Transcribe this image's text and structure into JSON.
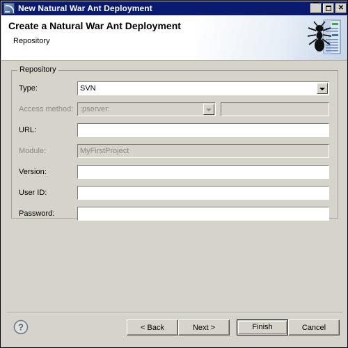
{
  "window": {
    "title": "New Natural War Ant Deployment",
    "icon": "wizard-window-icon",
    "controls": {
      "minimize": "minimize-button",
      "maximize": "maximize-button",
      "close": "close-button",
      "close_glyph": "✕"
    }
  },
  "header": {
    "title": "Create a Natural War Ant Deployment",
    "subtitle": "Repository",
    "icon": "ant-deployment-icon"
  },
  "repository_group": {
    "legend": "Repository",
    "rows": [
      {
        "label": "Type:",
        "control": "combo",
        "value": "SVN",
        "disabled": false,
        "name": "type"
      },
      {
        "label": "Access method:",
        "control": "combo",
        "value": ":pserver:",
        "disabled": true,
        "name": "access-method",
        "extra_field": {
          "value": "",
          "disabled": true,
          "name": "access-method-host"
        }
      },
      {
        "label": "URL:",
        "control": "text",
        "value": "",
        "disabled": false,
        "name": "url"
      },
      {
        "label": "Module:",
        "control": "text",
        "value": "MyFirstProject",
        "disabled": true,
        "name": "module"
      },
      {
        "label": "Version:",
        "control": "text",
        "value": "",
        "disabled": false,
        "name": "version"
      },
      {
        "label": "User ID:",
        "control": "text",
        "value": "",
        "disabled": false,
        "name": "user-id"
      },
      {
        "label": "Password:",
        "control": "text",
        "value": "",
        "disabled": false,
        "name": "password"
      }
    ]
  },
  "footer": {
    "help_icon": "help-question-icon",
    "help_glyph": "?",
    "buttons": [
      {
        "label": "< Back",
        "name": "back-button",
        "default": false
      },
      {
        "label": "Next >",
        "name": "next-button",
        "default": false
      },
      {
        "label": "Finish",
        "name": "finish-button",
        "default": true
      },
      {
        "label": "Cancel",
        "name": "cancel-button",
        "default": false
      }
    ]
  },
  "colors": {
    "titlebar": "#0a1a6e",
    "dialog_face": "#d6d3ca",
    "field_bg": "#ffffff",
    "disabled_text": "#8c8a84",
    "header_bg": "#ffffff"
  }
}
